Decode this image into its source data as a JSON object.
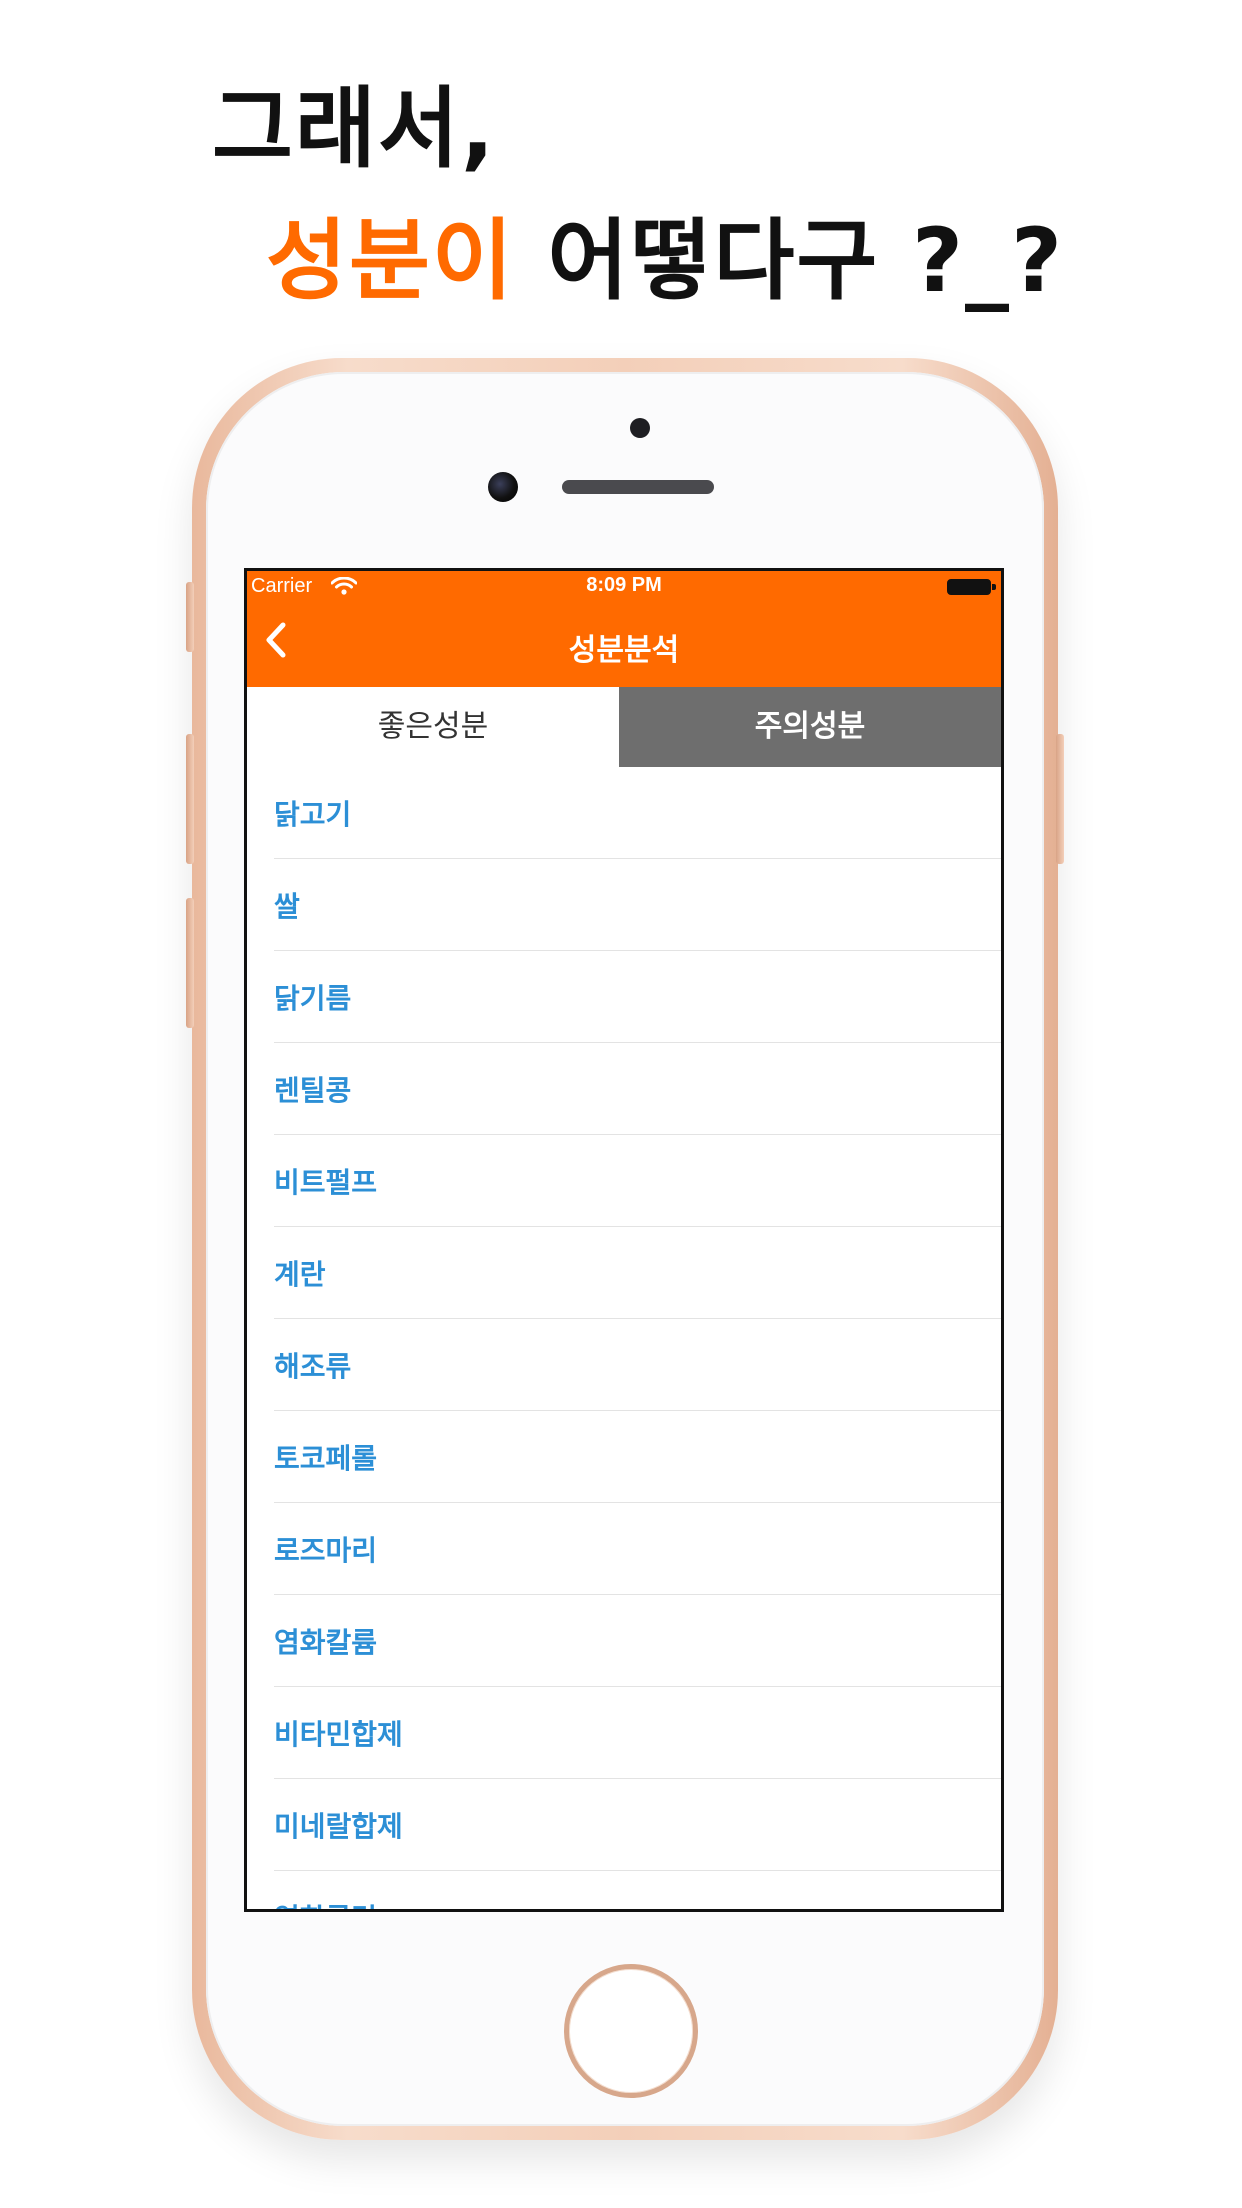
{
  "headline": {
    "line1": "그래서,",
    "line2_accent": "성분이",
    "line2_rest": " 어떻다구 ?_?"
  },
  "status_bar": {
    "carrier": "Carrier",
    "time": "8:09 PM",
    "icons": [
      "wifi-icon",
      "battery-icon"
    ]
  },
  "nav": {
    "title": "성분분석",
    "back_icon": "chevron-left-icon"
  },
  "tabs": [
    {
      "label": "좋은성분",
      "selected": true
    },
    {
      "label": "주의성분",
      "selected": false
    }
  ],
  "ingredients": [
    "닭고기",
    "쌀",
    "닭기름",
    "렌틸콩",
    "비트펄프",
    "계란",
    "해조류",
    "토코페롤",
    "로즈마리",
    "염화칼륨",
    "비타민합제",
    "미네랄합제",
    "염화콜린"
  ],
  "colors": {
    "accent": "#ff6a00",
    "tab_inactive": "#6e6e6e",
    "list_text": "#2c8fd6",
    "phone_gold": "#f3cfb9"
  }
}
